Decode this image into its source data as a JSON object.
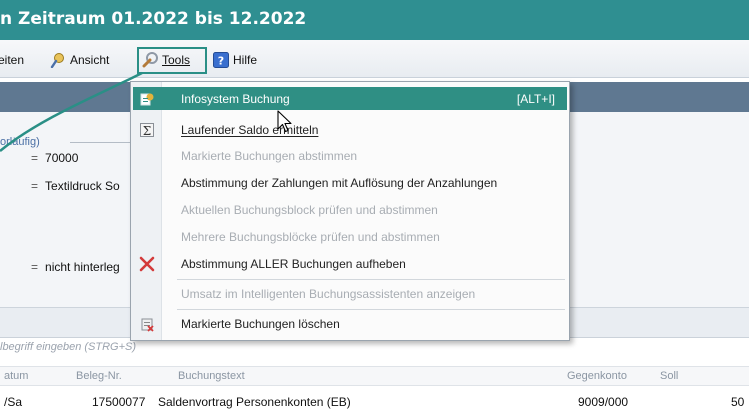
{
  "window": {
    "title": "n Zeitraum 01.2022 bis 12.2022"
  },
  "menubar": {
    "items": [
      {
        "label": "eiten",
        "icon": null
      },
      {
        "label": "Ansicht",
        "icon": "view-icon"
      },
      {
        "label": "Tools",
        "icon": "tools-icon"
      },
      {
        "label": "Hilfe",
        "icon": "help-icon"
      }
    ]
  },
  "panel": {
    "group_label": "orläufig)",
    "rows": [
      "70000",
      "Textildruck So",
      "nicht hinterleg"
    ],
    "eq": "="
  },
  "tools_menu": {
    "items": [
      {
        "label": "Infosystem Buchung",
        "shortcut": "[ALT+I]",
        "icon": "infosystem-icon",
        "highlighted": true,
        "disabled": false
      },
      {
        "label": "Laufender Saldo ermitteln",
        "shortcut": "",
        "icon": "sum-icon",
        "highlighted": false,
        "disabled": false
      },
      {
        "label": "Markierte Buchungen abstimmen",
        "shortcut": "",
        "icon": null,
        "highlighted": false,
        "disabled": true
      },
      {
        "label": "Abstimmung der Zahlungen mit Auflösung der Anzahlungen",
        "shortcut": "",
        "icon": null,
        "highlighted": false,
        "disabled": false
      },
      {
        "label": "Aktuellen Buchungsblock prüfen und abstimmen",
        "shortcut": "",
        "icon": null,
        "highlighted": false,
        "disabled": true
      },
      {
        "label": "Mehrere Buchungsblöcke prüfen und abstimmen",
        "shortcut": "",
        "icon": null,
        "highlighted": false,
        "disabled": true
      },
      {
        "label": "Abstimmung ALLER Buchungen aufheben",
        "shortcut": "",
        "icon": "red-x-icon",
        "highlighted": false,
        "disabled": false
      },
      {
        "label": "Umsatz im Intelligenten Buchungsassistenten anzeigen",
        "shortcut": "",
        "icon": null,
        "highlighted": false,
        "disabled": true
      },
      {
        "label": "Markierte Buchungen löschen",
        "shortcut": "",
        "icon": "delete-icon",
        "highlighted": false,
        "disabled": false
      }
    ]
  },
  "search_hint": "lbegriff eingeben (STRG+S)",
  "table": {
    "columns": [
      "atum",
      "Beleg-Nr.",
      "Buchungstext",
      "Gegenkonto",
      "Soll"
    ],
    "row": {
      "datum": "/Sa",
      "beleg": "17500077",
      "text": "Saldenvortrag Personenkonten (EB)",
      "gegenkonto": "9009/000",
      "soll": "50"
    }
  },
  "colors": {
    "titlebar": "#2f8f91",
    "accent": "#2a8f86",
    "highlight": "#2f8f84",
    "band": "#5f7891"
  }
}
